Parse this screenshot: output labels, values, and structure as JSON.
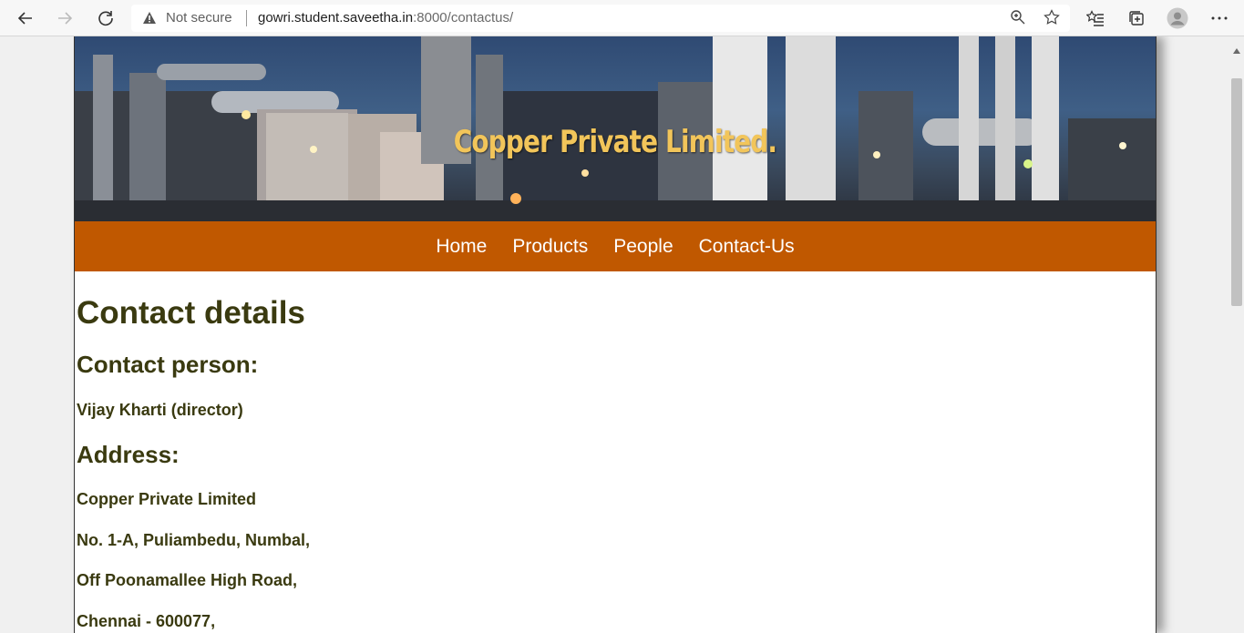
{
  "browser": {
    "security_label": "Not secure",
    "url_host": "gowri.student.saveetha.in",
    "url_rest": ":8000/contactus/",
    "icons": [
      "back-icon",
      "forward-icon",
      "reload-icon",
      "warning-icon",
      "zoom-icon",
      "star-icon",
      "favorites-icon",
      "collections-icon",
      "profile-icon",
      "more-icon"
    ]
  },
  "header": {
    "brand": "Copper Private Limited."
  },
  "nav": {
    "items": [
      "Home",
      "Products",
      "People",
      "Contact-Us"
    ]
  },
  "content": {
    "title": "Contact details",
    "person_heading": "Contact person:",
    "person": "Vijay Kharti (director)",
    "address_heading": "Address:",
    "address_lines": [
      "Copper Private Limited",
      "No. 1-A, Puliambedu, Numbal,",
      "Off Poonamallee High Road,",
      "Chennai - 600077,"
    ]
  },
  "colors": {
    "nav_bg": "#c05800",
    "brand_text": "#f2c55a",
    "content_text": "#3a3a10"
  }
}
